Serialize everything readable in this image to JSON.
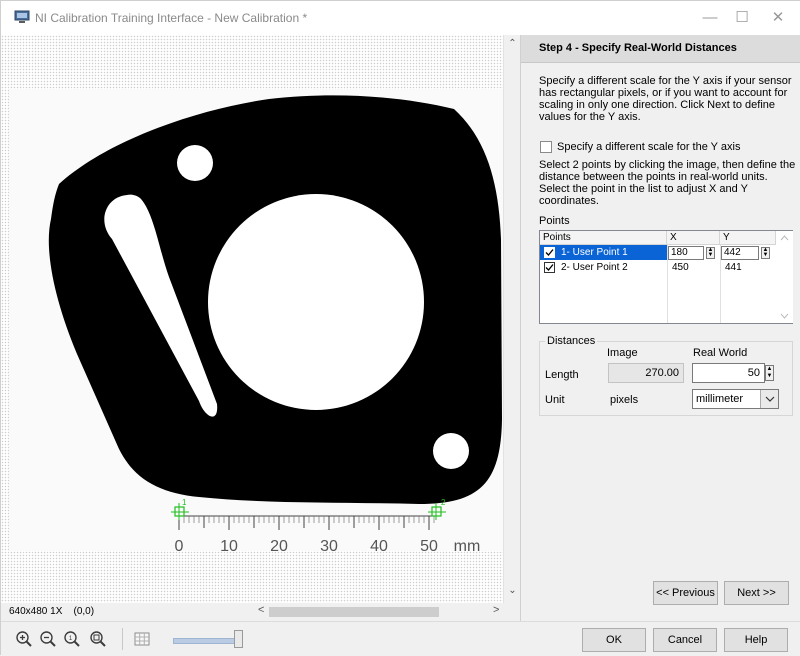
{
  "window": {
    "title": "NI Calibration Training Interface - New Calibration *",
    "minimize_glyph": "—",
    "maximize_glyph": "☐",
    "close_glyph": "✕"
  },
  "image_view": {
    "ruler_labels": [
      "0",
      "10",
      "20",
      "30",
      "40",
      "50"
    ],
    "ruler_unit": "mm",
    "point_markers": [
      "1",
      "2"
    ],
    "status": "640x480 1X    (0,0)",
    "scroll_up": "⌃",
    "scroll_down": "⌄",
    "scroll_left": "<",
    "scroll_right": ">"
  },
  "wizard": {
    "step_title": "Step 4 - Specify Real-World Distances",
    "intro": "Specify a different scale for the Y axis if your sensor has rectangular pixels, or if you want to account for scaling in only one direction. Click Next to define values for the Y axis.",
    "y_scale_checkbox": {
      "label": "Specify a different scale for the Y axis",
      "checked": false
    },
    "instructions": "Select 2 points by clicking the image, then define the distance between the points in real-world units. Select the point in the list to adjust X and Y coordinates.",
    "points": {
      "label": "Points",
      "columns": [
        "Points",
        "X",
        "Y"
      ],
      "rows": [
        {
          "name": "1- User Point 1",
          "x": "180",
          "y": "442",
          "checked": true,
          "selected": true
        },
        {
          "name": "2- User Point 2",
          "x": "450",
          "y": "441",
          "checked": true,
          "selected": false
        }
      ]
    },
    "distances": {
      "label": "Distances",
      "col_image": "Image",
      "col_real": "Real World",
      "length_label": "Length",
      "length_image": "270.00",
      "length_real": "50",
      "unit_label": "Unit",
      "unit_image": "pixels",
      "unit_real": "millimeter"
    },
    "prev_label": "<< Previous",
    "next_label": "Next >>"
  },
  "footer": {
    "ok_label": "OK",
    "cancel_label": "Cancel",
    "help_label": "Help",
    "zoom_slider_level": 0.95
  },
  "icons": [
    "zoom-in-icon",
    "zoom-out-icon",
    "zoom-1to1-icon",
    "zoom-fit-icon",
    "grid-icon"
  ]
}
